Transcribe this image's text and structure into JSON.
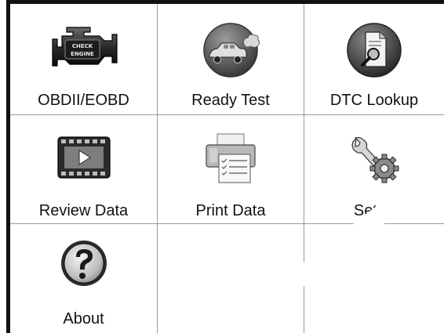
{
  "menu": {
    "tiles": [
      {
        "label": "OBDII/EOBD",
        "icon": "check-engine-icon"
      },
      {
        "label": "Ready Test",
        "icon": "car-emission-icon"
      },
      {
        "label": "DTC Lookup",
        "icon": "document-search-icon"
      },
      {
        "label": "Review Data",
        "icon": "video-film-icon"
      },
      {
        "label": "Print Data",
        "icon": "printer-icon"
      },
      {
        "label": "Setup",
        "icon": "wrench-gear-icon"
      },
      {
        "label": "About",
        "icon": "question-mark-icon"
      }
    ],
    "engine_badge_line1": "CHECK",
    "engine_badge_line2": "ENGINE"
  }
}
